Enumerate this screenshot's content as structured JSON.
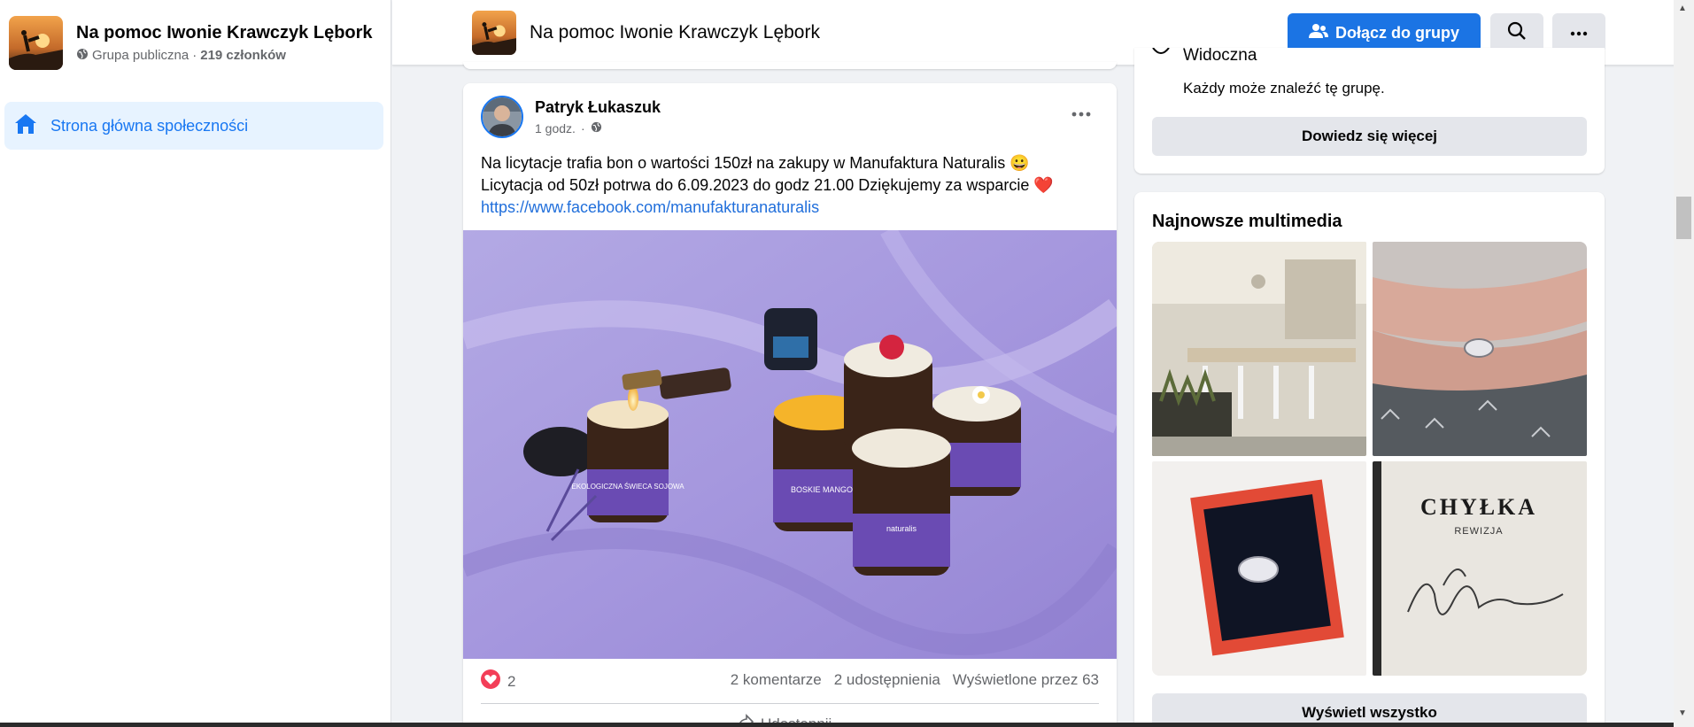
{
  "sidebar": {
    "group_name": "Na pomoc Iwonie Krawczyk Lębork",
    "privacy": "Grupa publiczna",
    "separator": " · ",
    "members": "219 członków",
    "nav_home": "Strona główna społeczności"
  },
  "header": {
    "title": "Na pomoc Iwonie Krawczyk Lębork",
    "join_label": "Dołącz do grupy"
  },
  "post": {
    "author": "Patryk Łukaszuk",
    "time": "1 godz.",
    "dot": "·",
    "line1": "Na licytacje trafia bon o wartości 150zł na zakupy w Manufaktura Naturalis 😀",
    "line2": "Licytacja od 50zł potrwa do 6.09.2023 do godz 21.00 Dziękujemy za wsparcie ❤️",
    "link": "https://www.facebook.com/manufakturanaturalis",
    "reaction_count": "2",
    "comments": "2 komentarze",
    "shares": "2 udostępnienia",
    "views": "Wyświetlone przez 63",
    "share_label": "Udostępnij",
    "image_labels": {
      "candle": "EKOLOGICZNA ŚWIECA SOJOWA",
      "mango": "BOSKIE MANGO",
      "brand": "naturalis"
    }
  },
  "about": {
    "visibility_title": "Widoczna",
    "visibility_desc": "Każdy może znaleźć tę grupę.",
    "learn_more": "Dowiedz się więcej"
  },
  "media": {
    "title": "Najnowsze multimedia",
    "view_all": "Wyświetl wszystko",
    "book_title": "CHYŁKA",
    "book_sub": "REWIZJA"
  },
  "colors": {
    "accent": "#1b74e4",
    "nav_bg": "#e7f3ff",
    "button_gray": "#e4e6eb"
  }
}
